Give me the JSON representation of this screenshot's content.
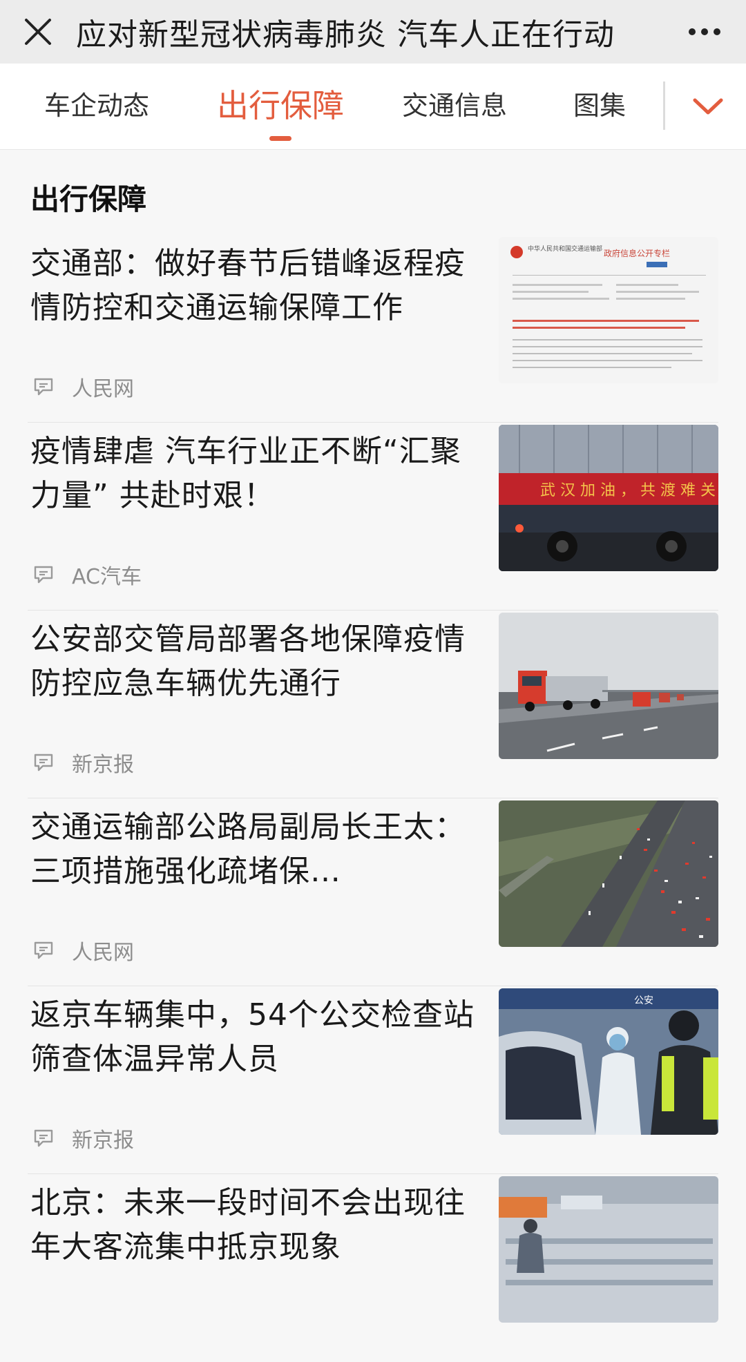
{
  "header": {
    "title": "应对新型冠状病毒肺炎 汽车人正在行动"
  },
  "tabs": [
    {
      "label": "车企动态"
    },
    {
      "label": "出行保障"
    },
    {
      "label": "交通信息"
    },
    {
      "label": "图集"
    }
  ],
  "active_tab": "出行保障",
  "section": {
    "title": "出行保障"
  },
  "articles": [
    {
      "title": "交通部：做好春节后错峰返程疫情防控和交通运输保障工作",
      "source": "人民网",
      "thumb": "government-notice-document",
      "thumb_text": [
        "中华人民共和国交通运输部",
        "政府信息公开专栏"
      ]
    },
    {
      "title": "疫情肆虐 汽车行业正不断“汇聚力量” 共赴时艰！",
      "source": "AC汽车",
      "thumb": "red-banner-truck",
      "thumb_text": [
        "武 汉 加 油 ， 共 渡 难 关"
      ]
    },
    {
      "title": "公安部交管局部署各地保障疫情防控应急车辆优先通行",
      "source": "新京报",
      "thumb": "trucks-on-highway"
    },
    {
      "title": "交通运输部公路局副局长王太：三项措施强化疏堵保…",
      "source": "人民网",
      "thumb": "highway-traffic-aerial"
    },
    {
      "title": "返京车辆集中，54个公交检查站筛查体温异常人员",
      "source": "新京报",
      "thumb": "checkpoint-temperature-screening",
      "thumb_text": [
        "公安"
      ]
    },
    {
      "title": "北京：未来一段时间不会出现往年大客流集中抵京现象",
      "source": "",
      "thumb": "station-hall"
    }
  ],
  "colors": {
    "accent": "#e35d3e",
    "topbar": "#ececec",
    "background": "#f7f7f7"
  }
}
